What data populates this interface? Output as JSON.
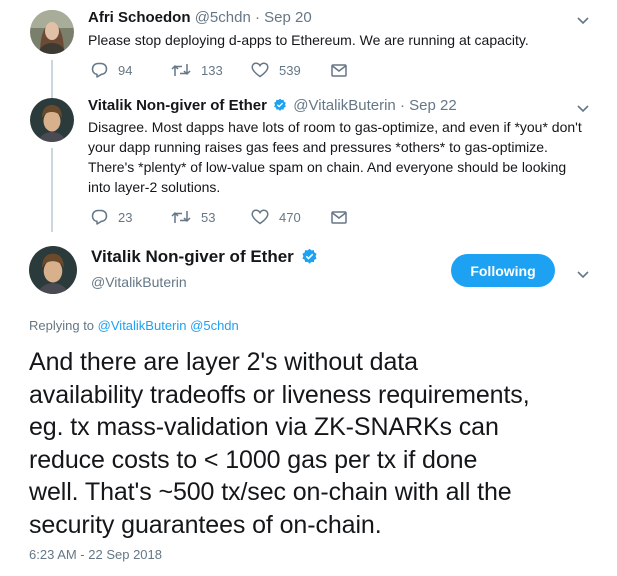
{
  "tweets": [
    {
      "name": "Afri Schoedon",
      "handle": "@5chdn",
      "date": "· Sep 20",
      "text": "Please stop deploying d-apps to Ethereum. We are running at capacity.",
      "replies": "94",
      "retweets": "133",
      "likes": "539"
    },
    {
      "name": "Vitalik Non-giver of Ether",
      "handle": "@VitalikButerin",
      "date": "· Sep 22",
      "text_lines": [
        "Disagree. Most dapps have lots of room to gas-optimize, and even if *you* don't",
        "your dapp running raises gas fees and pressures *others* to gas-optimize.",
        "There's *plenty* of low-value spam on chain. And everyone should be looking",
        "into layer-2 solutions."
      ],
      "replies": "23",
      "retweets": "53",
      "likes": "470"
    }
  ],
  "main_tweet": {
    "name": "Vitalik Non-giver of Ether",
    "handle": "@VitalikButerin",
    "follow_label": "Following",
    "replying_prefix": "Replying to",
    "replying_to": [
      "@VitalikButerin",
      "@5chdn"
    ],
    "text_lines": [
      "And there are layer 2's without data",
      "availability tradeoffs or liveness requirements,",
      "eg. tx mass-validation via ZK-SNARKs can",
      "reduce costs to < 1000 gas per tx if done",
      "well. That's ~500 tx/sec on-chain with all the",
      "security guarantees of on-chain."
    ],
    "timestamp": "6:23 AM - 22 Sep 2018"
  },
  "icons": {
    "reply": "reply-icon",
    "retweet": "retweet-icon",
    "like": "heart-icon",
    "message": "envelope-icon",
    "verified": "verified-badge-icon",
    "caret": "chevron-down-icon"
  },
  "colors": {
    "accent": "#1da1f2",
    "muted": "#657786",
    "text": "#14171a",
    "thread_line": "#ccd6dd"
  }
}
